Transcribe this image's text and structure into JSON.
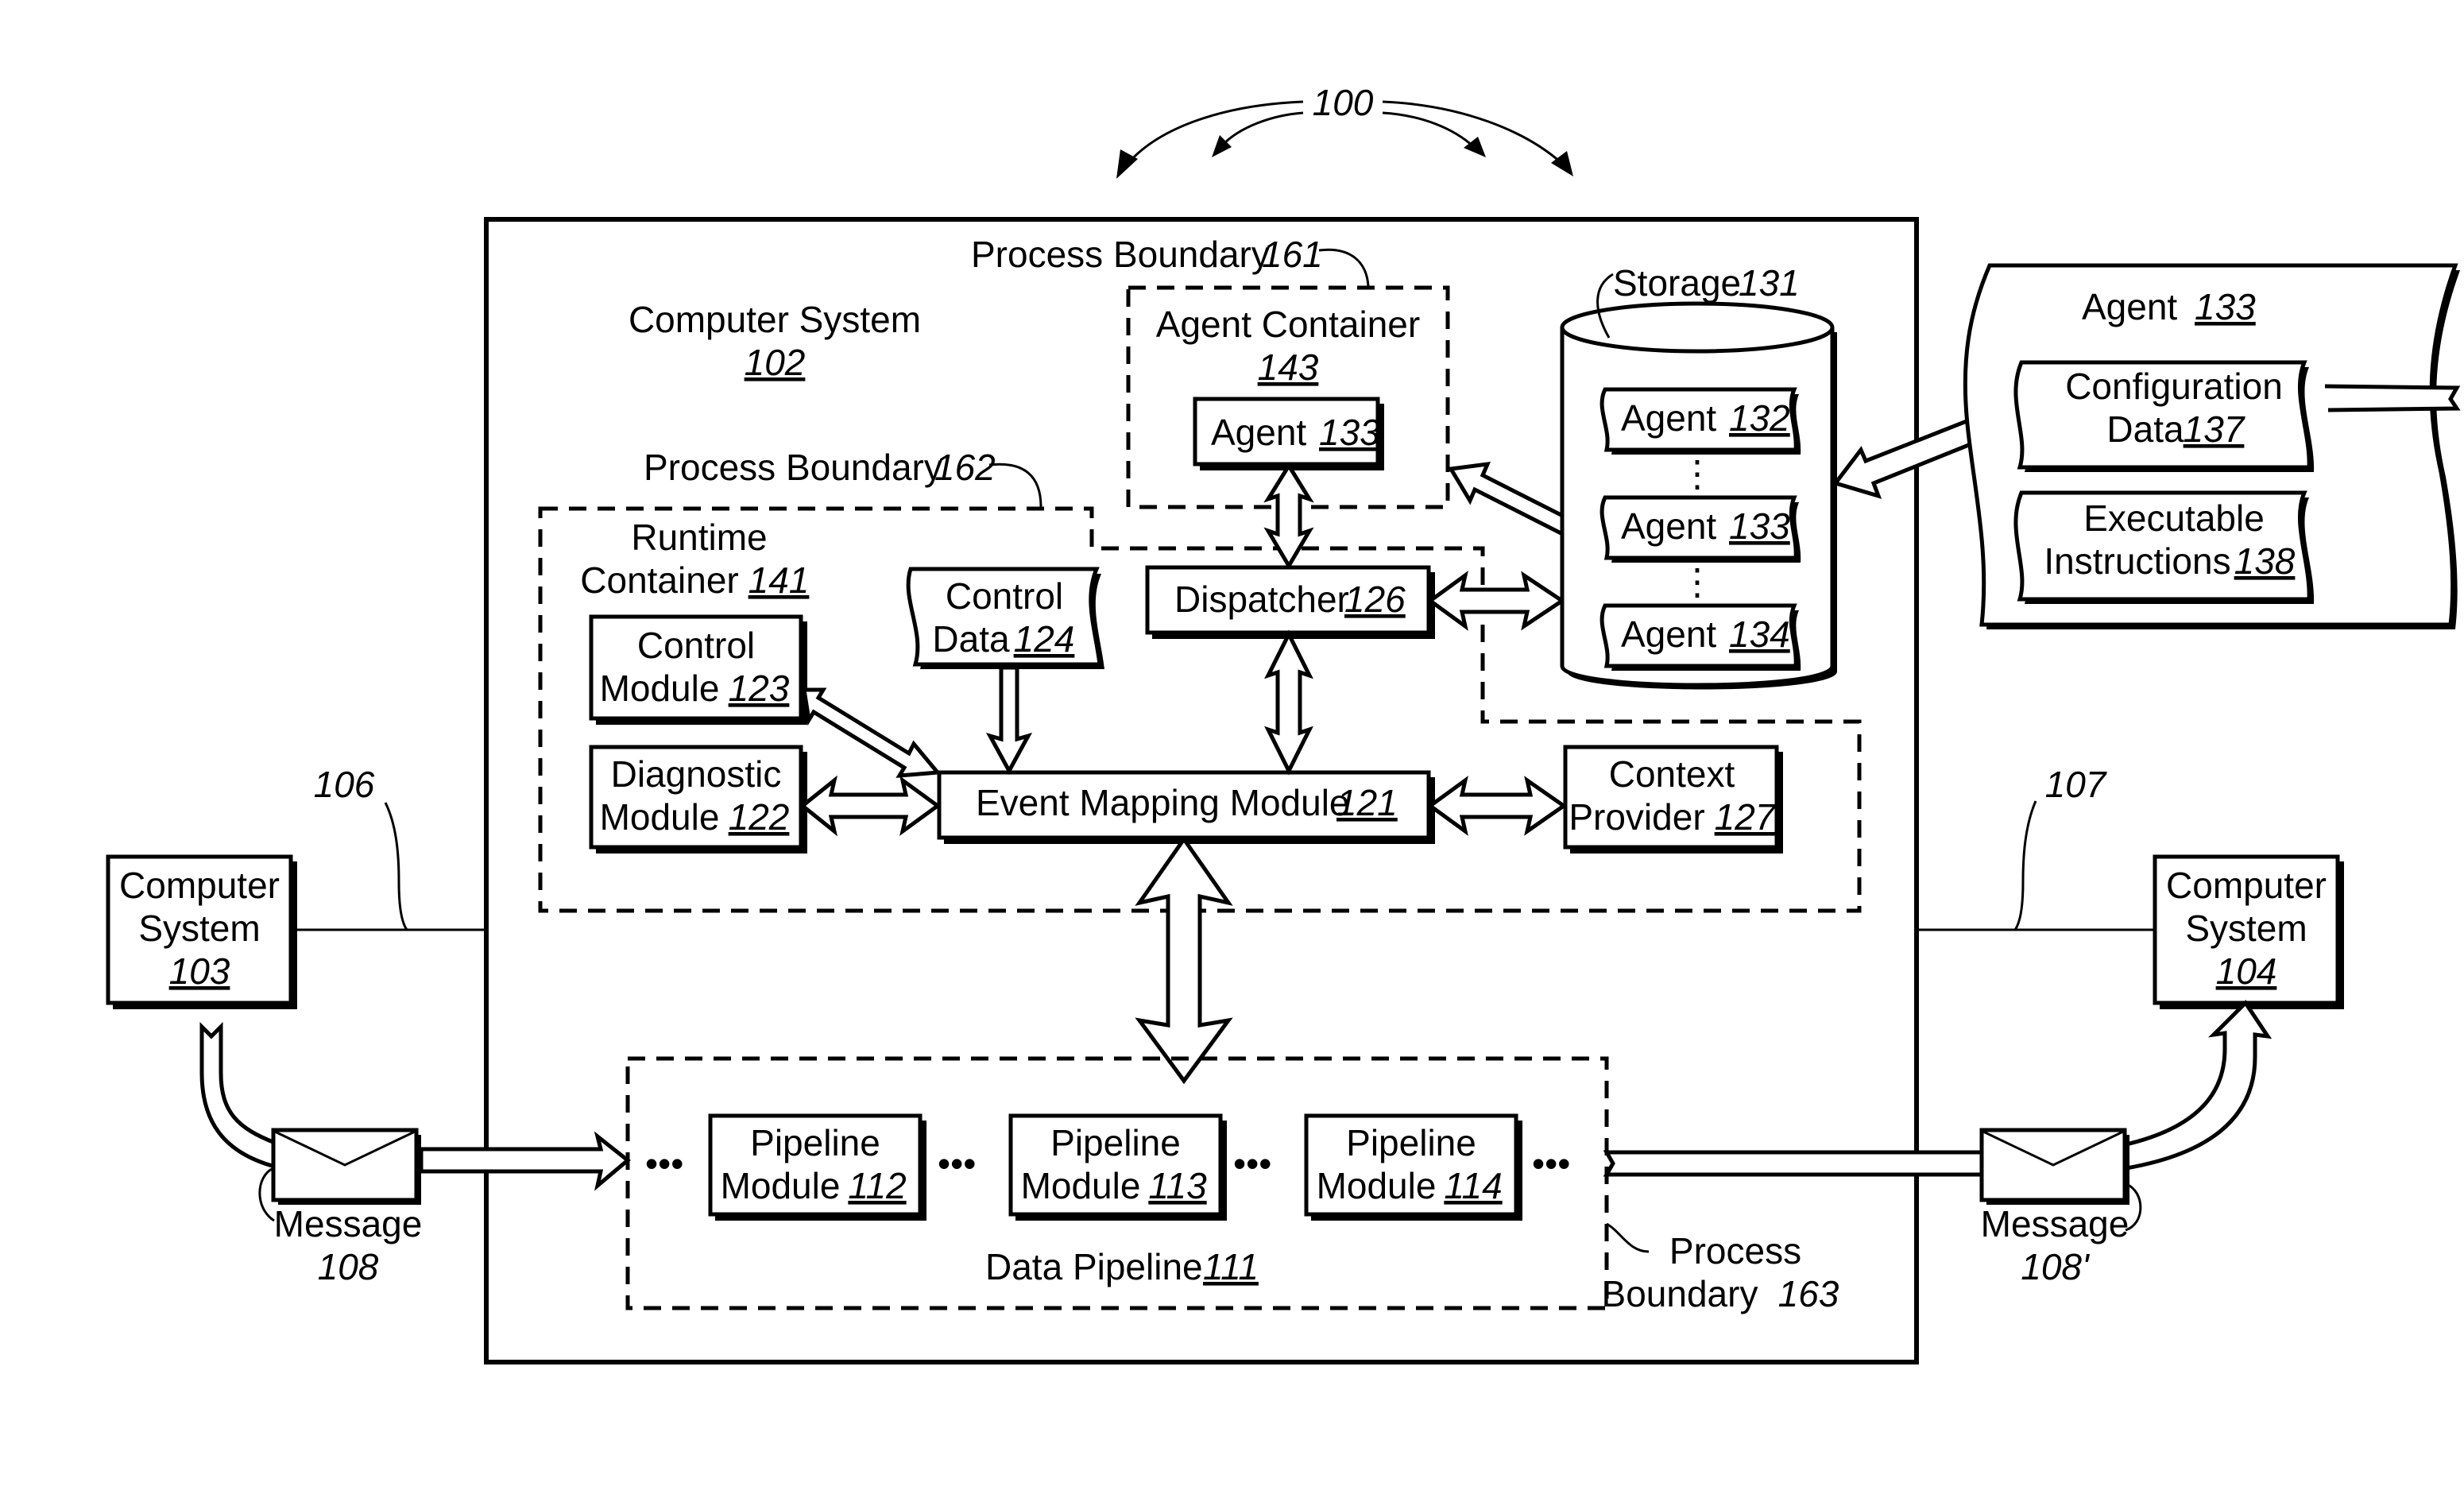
{
  "figure": {
    "ref_label": "100"
  },
  "computer_system_main": {
    "name": "Computer System",
    "ref": "102"
  },
  "process_boundary_161": {
    "name": "Process Boundary",
    "ref": "161"
  },
  "process_boundary_162": {
    "name": "Process Boundary",
    "ref": "162"
  },
  "process_boundary_163": {
    "line1": "Process",
    "line2": "Boundary",
    "ref": "163"
  },
  "agent_container": {
    "name": "Agent Container",
    "ref": "143",
    "agent": {
      "name": "Agent",
      "ref": "133"
    }
  },
  "runtime_container": {
    "line1": "Runtime",
    "line2": "Container",
    "ref": "141"
  },
  "control_data": {
    "line1": "Control",
    "line2": "Data",
    "ref": "124"
  },
  "dispatcher": {
    "name": "Dispatcher",
    "ref": "126"
  },
  "control_module": {
    "line1": "Control",
    "line2": "Module",
    "ref": "123"
  },
  "diagnostic_module": {
    "line1": "Diagnostic",
    "line2": "Module",
    "ref": "122"
  },
  "event_mapping_module": {
    "name": "Event Mapping Module",
    "ref": "121"
  },
  "context_provider": {
    "line1": "Context",
    "line2": "Provider",
    "ref": "127"
  },
  "storage": {
    "name": "Storage",
    "ref": "131",
    "agents": [
      {
        "name": "Agent",
        "ref": "132"
      },
      {
        "name": "Agent",
        "ref": "133"
      },
      {
        "name": "Agent",
        "ref": "134"
      }
    ]
  },
  "agent_document": {
    "name": "Agent",
    "ref": "133",
    "config": {
      "line1": "Configuration",
      "line2": "Data",
      "ref": "137"
    },
    "instructions": {
      "line1": "Executable",
      "line2": "Instructions",
      "ref": "138"
    }
  },
  "data_pipeline": {
    "name": "Data Pipeline",
    "ref": "111",
    "modules": [
      {
        "line1": "Pipeline",
        "line2": "Module",
        "ref": "112"
      },
      {
        "line1": "Pipeline",
        "line2": "Module",
        "ref": "113"
      },
      {
        "line1": "Pipeline",
        "line2": "Module",
        "ref": "114"
      }
    ],
    "ellipsis": "•••"
  },
  "computer_system_103": {
    "line1": "Computer",
    "line2": "System",
    "ref": "103"
  },
  "computer_system_104": {
    "line1": "Computer",
    "line2": "System",
    "ref": "104"
  },
  "network_106": {
    "ref": "106"
  },
  "network_107": {
    "ref": "107"
  },
  "message_in": {
    "name": "Message",
    "ref": "108"
  },
  "message_out": {
    "name": "Message",
    "ref": "108'"
  },
  "storage_dots": "⋮"
}
